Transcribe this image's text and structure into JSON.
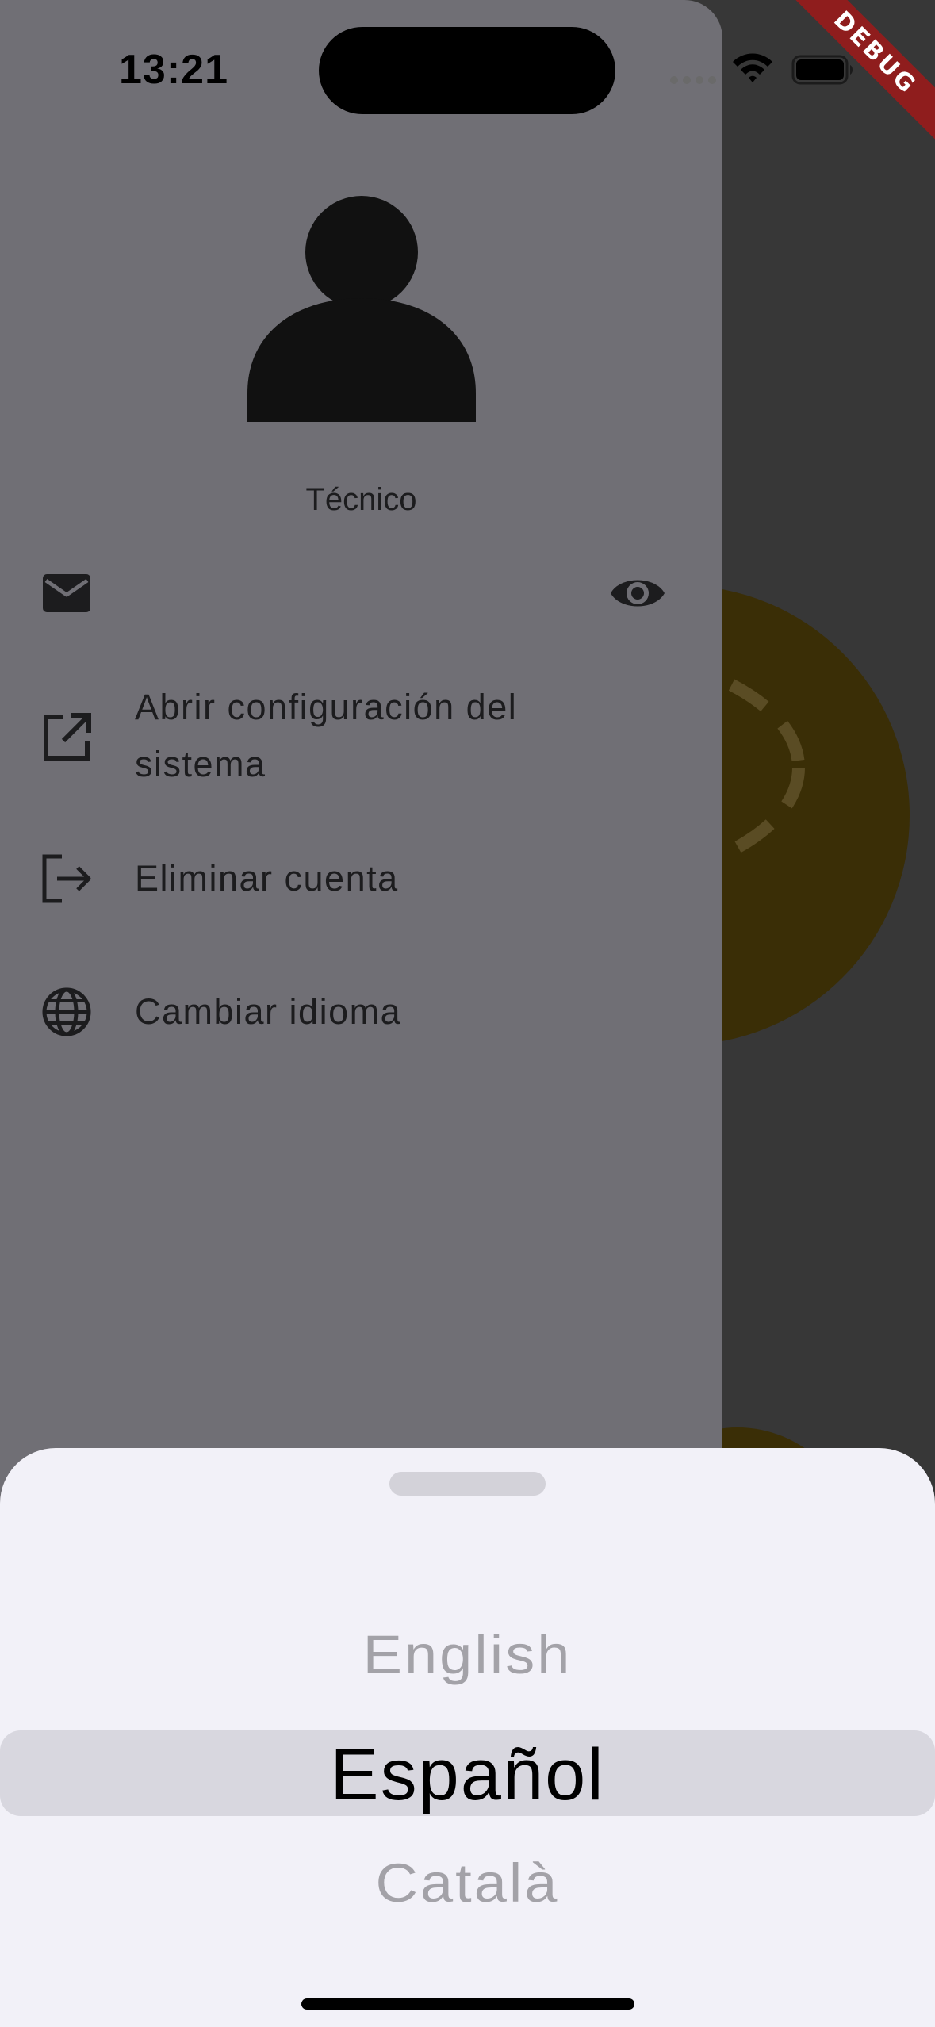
{
  "status_bar": {
    "time": "13:21"
  },
  "debug_banner": {
    "label": "DEBUG"
  },
  "drawer": {
    "username": "Técnico",
    "items": [
      {
        "icon": "mail-icon",
        "label": ""
      },
      {
        "icon": "open-in-new-icon",
        "label_line1": "Abrir configuración del",
        "label_line2": "sistema"
      },
      {
        "icon": "logout-icon",
        "label": "Eliminar cuenta"
      },
      {
        "icon": "globe-icon",
        "label": "Cambiar idioma"
      }
    ]
  },
  "language_picker": {
    "options": [
      "English",
      "Español",
      "Català"
    ],
    "selected": "Español"
  },
  "colors": {
    "drawer_bg": "#706f75",
    "sheet_bg": "#f2f1f8",
    "picker_highlight": "#d8d7df",
    "debug_red": "#8f1d1d",
    "background_accent": "#3a2e06"
  }
}
